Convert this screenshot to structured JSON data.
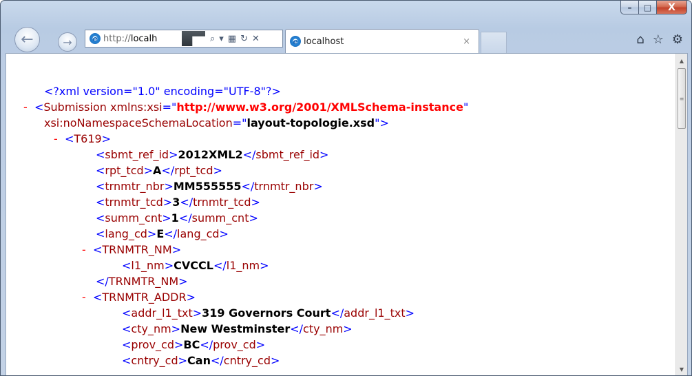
{
  "window": {
    "controls": {
      "minimize": "–",
      "maximize": "□",
      "close": "X"
    }
  },
  "nav": {
    "back_glyph": "←",
    "forward_glyph": "→",
    "address": {
      "protocol": "http://",
      "host": "localh",
      "icons": {
        "search": "⌕",
        "dropdown": "▾",
        "compat": "▦",
        "refresh": "↻",
        "stop": "✕"
      }
    },
    "tab": {
      "title": "localhost",
      "close_glyph": "×"
    },
    "icons": {
      "home": "⌂",
      "favorites": "☆",
      "tools": "⚙"
    }
  },
  "xml": {
    "declaration": "<?xml version=\"1.0\" encoding=\"UTF-8\"?>",
    "minus": "-",
    "submission": {
      "open_name": "Submission",
      "attr1_name": "xmlns:xsi",
      "attr1_value": "http://www.w3.org/2001/XMLSchema-instance",
      "attr2_name": "xsi:noNamespaceSchemaLocation",
      "attr2_value": "layout-topologie.xsd"
    },
    "t619": "T619",
    "fields": [
      {
        "tag": "sbmt_ref_id",
        "value": "2012XML2"
      },
      {
        "tag": "rpt_tcd",
        "value": "A"
      },
      {
        "tag": "trnmtr_nbr",
        "value": "MM555555"
      },
      {
        "tag": "trnmtr_tcd",
        "value": "3"
      },
      {
        "tag": "summ_cnt",
        "value": "1"
      },
      {
        "tag": "lang_cd",
        "value": "E"
      }
    ],
    "trnmtr_nm": {
      "tag": "TRNMTR_NM",
      "child": {
        "tag": "l1_nm",
        "value": "CVCCL"
      }
    },
    "trnmtr_addr": {
      "tag": "TRNMTR_ADDR",
      "children": [
        {
          "tag": "addr_l1_txt",
          "value": "319 Governors Court"
        },
        {
          "tag": "cty_nm",
          "value": "New Westminster"
        },
        {
          "tag": "prov_cd",
          "value": "BC"
        },
        {
          "tag": "cntry_cd",
          "value": "Can"
        }
      ]
    }
  },
  "scrollbar": {
    "up": "▲",
    "down": "▼",
    "grip": "≡"
  }
}
